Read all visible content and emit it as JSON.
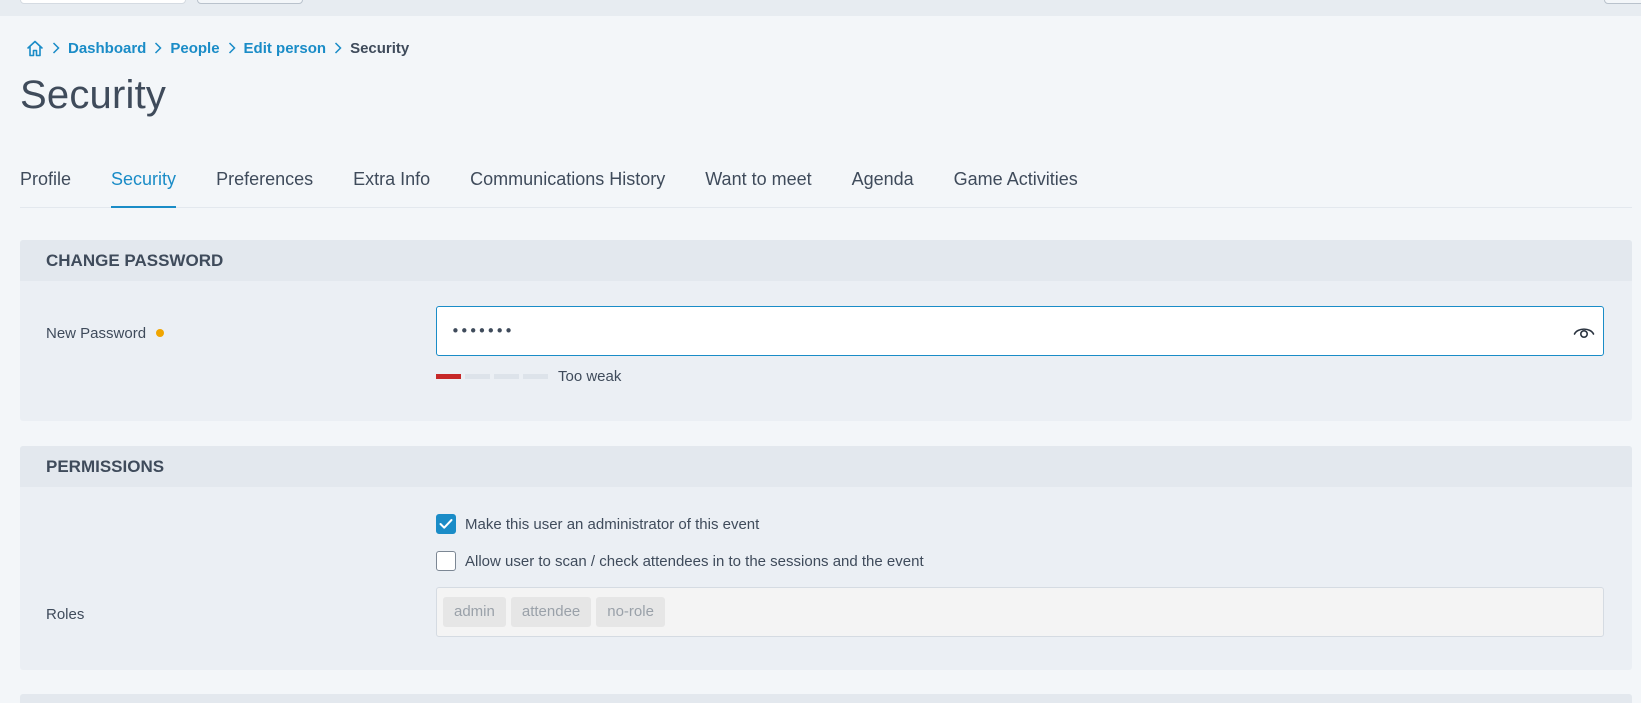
{
  "breadcrumb": {
    "home_icon": "home-icon",
    "items": [
      "Dashboard",
      "People",
      "Edit person"
    ],
    "current": "Security"
  },
  "page": {
    "title": "Security"
  },
  "tabs": [
    {
      "label": "Profile",
      "active": false
    },
    {
      "label": "Security",
      "active": true
    },
    {
      "label": "Preferences",
      "active": false
    },
    {
      "label": "Extra Info",
      "active": false
    },
    {
      "label": "Communications History",
      "active": false
    },
    {
      "label": "Want to meet",
      "active": false
    },
    {
      "label": "Agenda",
      "active": false
    },
    {
      "label": "Game Activities",
      "active": false
    }
  ],
  "change_password": {
    "header": "CHANGE PASSWORD",
    "new_password_label": "New Password",
    "new_password_value": "•••••••",
    "show_password_icon": "eye-icon",
    "strength": {
      "level": 1,
      "max": 4,
      "label": "Too weak"
    }
  },
  "permissions": {
    "header": "PERMISSIONS",
    "admin_checkbox": {
      "label": "Make this user an administrator of this event",
      "checked": true
    },
    "scan_checkbox": {
      "label": "Allow user to scan / check attendees in to the sessions and the event",
      "checked": false
    },
    "roles_label": "Roles",
    "roles": [
      "admin",
      "attendee",
      "no-role"
    ]
  },
  "colors": {
    "accent": "#1a8cc7",
    "required": "#f0a500",
    "weak": "#c62828",
    "background": "#f3f6f9"
  }
}
